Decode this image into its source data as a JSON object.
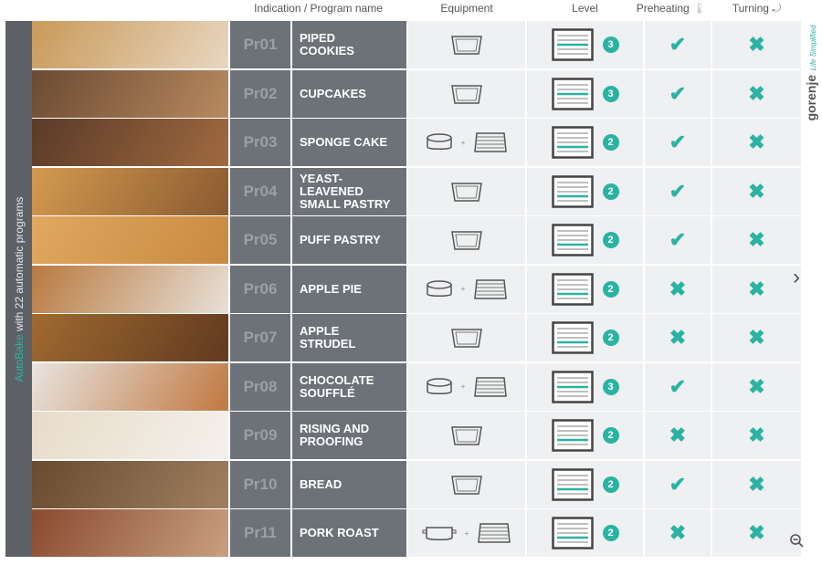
{
  "headers": {
    "program": "Indication / Program name",
    "equipment": "Equipment",
    "level": "Level",
    "preheating": "Preheating",
    "turning": "Turning"
  },
  "sidebar": {
    "brand_word": "AutoBake",
    "rest": " with 22 automatic programs"
  },
  "logo": {
    "name": "gorenje",
    "tagline": "Life Simplified"
  },
  "colors": {
    "accent": "#2ab3a3",
    "label_bg": "#6d7278",
    "cell_bg": "#eef0f2"
  },
  "rows": [
    {
      "code": "Pr01",
      "name": "PIPED\nCOOKIES",
      "equipment": "tray",
      "level": "3",
      "preheating": "✔",
      "turning": "✖"
    },
    {
      "code": "Pr02",
      "name": "CUPCAKES",
      "equipment": "tray",
      "level": "3",
      "preheating": "✔",
      "turning": "✖"
    },
    {
      "code": "Pr03",
      "name": "SPONGE CAKE",
      "equipment": "pan+rack",
      "level": "2",
      "preheating": "✔",
      "turning": "✖"
    },
    {
      "code": "Pr04",
      "name": "YEAST-\nLEAVENED\nSMALL PASTRY",
      "equipment": "tray",
      "level": "2",
      "preheating": "✔",
      "turning": "✖"
    },
    {
      "code": "Pr05",
      "name": "PUFF PASTRY",
      "equipment": "tray",
      "level": "2",
      "preheating": "✔",
      "turning": "✖"
    },
    {
      "code": "Pr06",
      "name": "APPLE PIE",
      "equipment": "pan+rack",
      "level": "2",
      "preheating": "✖",
      "turning": "✖"
    },
    {
      "code": "Pr07",
      "name": "APPLE\nSTRUDEL",
      "equipment": "tray",
      "level": "2",
      "preheating": "✖",
      "turning": "✖"
    },
    {
      "code": "Pr08",
      "name": "CHOCOLATE\nSOUFFLÉ",
      "equipment": "pan+rack",
      "level": "3",
      "preheating": "✔",
      "turning": "✖"
    },
    {
      "code": "Pr09",
      "name": "RISING AND\nPROOFING",
      "equipment": "tray",
      "level": "2",
      "preheating": "✖",
      "turning": "✖"
    },
    {
      "code": "Pr10",
      "name": "BREAD",
      "equipment": "tray",
      "level": "2",
      "preheating": "✔",
      "turning": "✖"
    },
    {
      "code": "Pr11",
      "name": "PORK ROAST",
      "equipment": "roaster+rack",
      "level": "2",
      "preheating": "✖",
      "turning": "✖"
    }
  ],
  "controls": {
    "next": "›"
  }
}
